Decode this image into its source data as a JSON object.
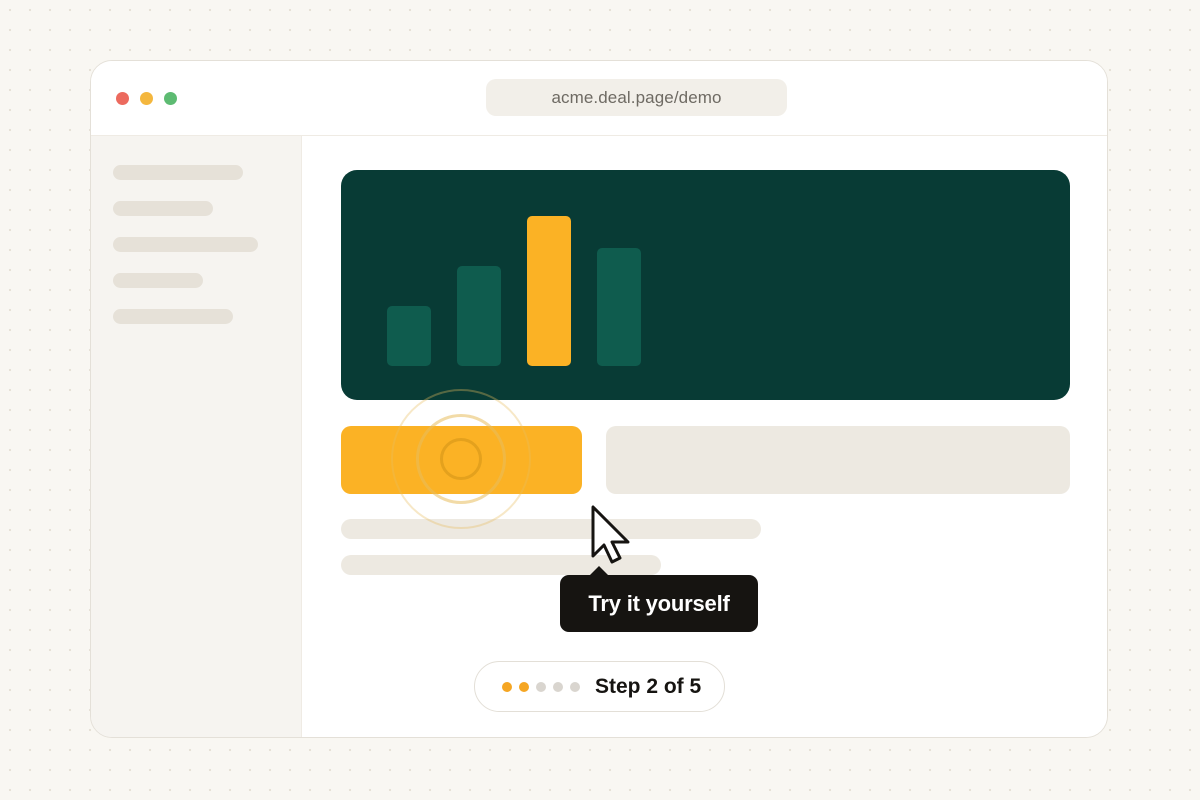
{
  "browser": {
    "url": "acme.deal.page/demo"
  },
  "hero_chart": {
    "type": "bar",
    "values": [
      3,
      5,
      7.5,
      5.9
    ],
    "highlighted_index": 2,
    "colors": {
      "bar": "#0f5c4e",
      "highlight": "#fbb225",
      "background": "#083b35"
    }
  },
  "tooltip": {
    "text": "Try it yourself"
  },
  "stepper": {
    "label": "Step 2 of 5",
    "current": 2,
    "total": 5
  },
  "cursor": {
    "icon": "pointer-arrow-icon"
  },
  "colors": {
    "accent": "#fbb225",
    "dark_green": "#083b35",
    "tooltip_bg": "#161411"
  }
}
